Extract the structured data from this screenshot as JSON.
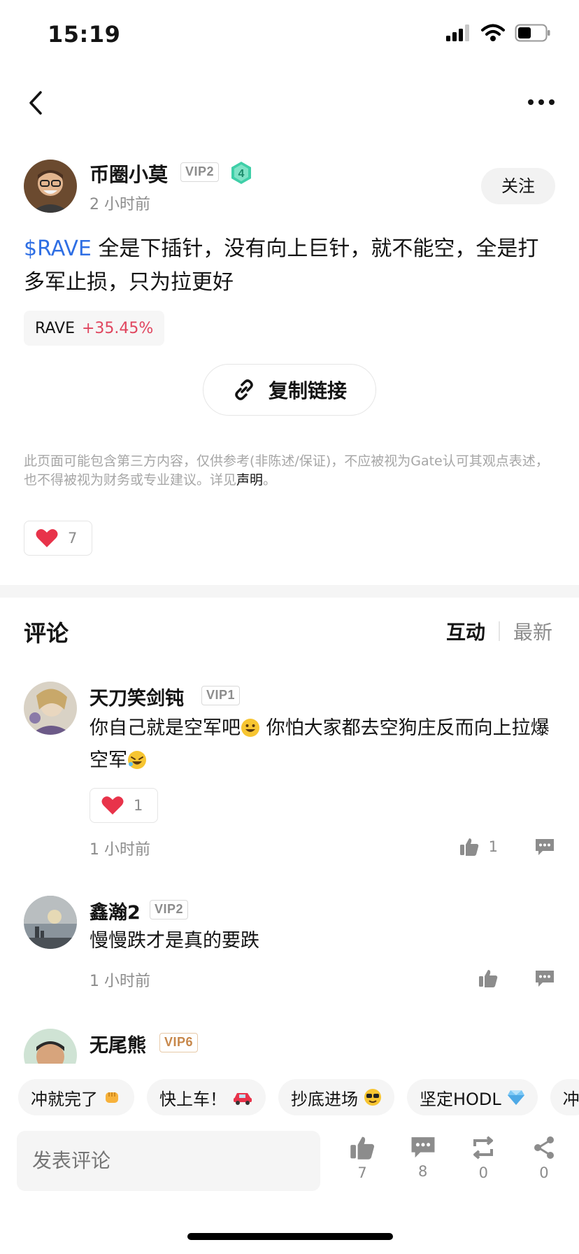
{
  "status_bar": {
    "time": "15:19"
  },
  "author": {
    "name": "币圈小莫",
    "vip": "VIP2",
    "level": "4",
    "time": "2 小时前",
    "follow_label": "关注"
  },
  "post": {
    "ticker_link": "$RAVE",
    "text": " 全是下插针，没有向上巨针，就不能空，全是打多军止损，只为拉更好",
    "ticker_chip": {
      "name": "RAVE",
      "change": "+35.45%"
    },
    "copy_link_label": "复制链接",
    "disclaimer_text": "此页面可能包含第三方内容，仅供参考(非陈述/保证)，不应被视为Gate认可其观点表述，也不得被视为财务或专业建议。详见",
    "disclaimer_link": "声明",
    "disclaimer_end": "。",
    "like_count": "7"
  },
  "comments_header": {
    "title": "评论",
    "sort_hot": "互动",
    "sort_new": "最新"
  },
  "comments": [
    {
      "name": "天刀笑剑钝",
      "vip": "VIP1",
      "text_a": "你自己就是空军吧",
      "text_b": " 你怕大家都去空狗庄反而向上拉爆空军",
      "like_box_count": "1",
      "time": "1 小时前",
      "thumbs_count": "1"
    },
    {
      "name": "鑫瀚2",
      "vip": "VIP2",
      "text": "慢慢跌才是真的要跌",
      "time": "1 小时前"
    },
    {
      "name": "无尾熊",
      "vip": "VIP6"
    }
  ],
  "quick_replies": [
    {
      "label": "冲就完了",
      "icon": "fist-emoji"
    },
    {
      "label": "快上车！",
      "icon": "car-emoji"
    },
    {
      "label": "抄底进场",
      "icon": "cool-emoji"
    },
    {
      "label": "坚定HODL",
      "icon": "diamond-emoji"
    },
    {
      "label": "冲",
      "icon": ""
    }
  ],
  "bottom_bar": {
    "input_placeholder": "发表评论",
    "like_count": "7",
    "comment_count": "8",
    "repost_count": "0",
    "share_count": "0"
  },
  "colors": {
    "accent_blue": "#2f6fe4",
    "price_up": "#e0455e",
    "heart": "#e8334a",
    "level_badge": "#3fcfa8"
  }
}
